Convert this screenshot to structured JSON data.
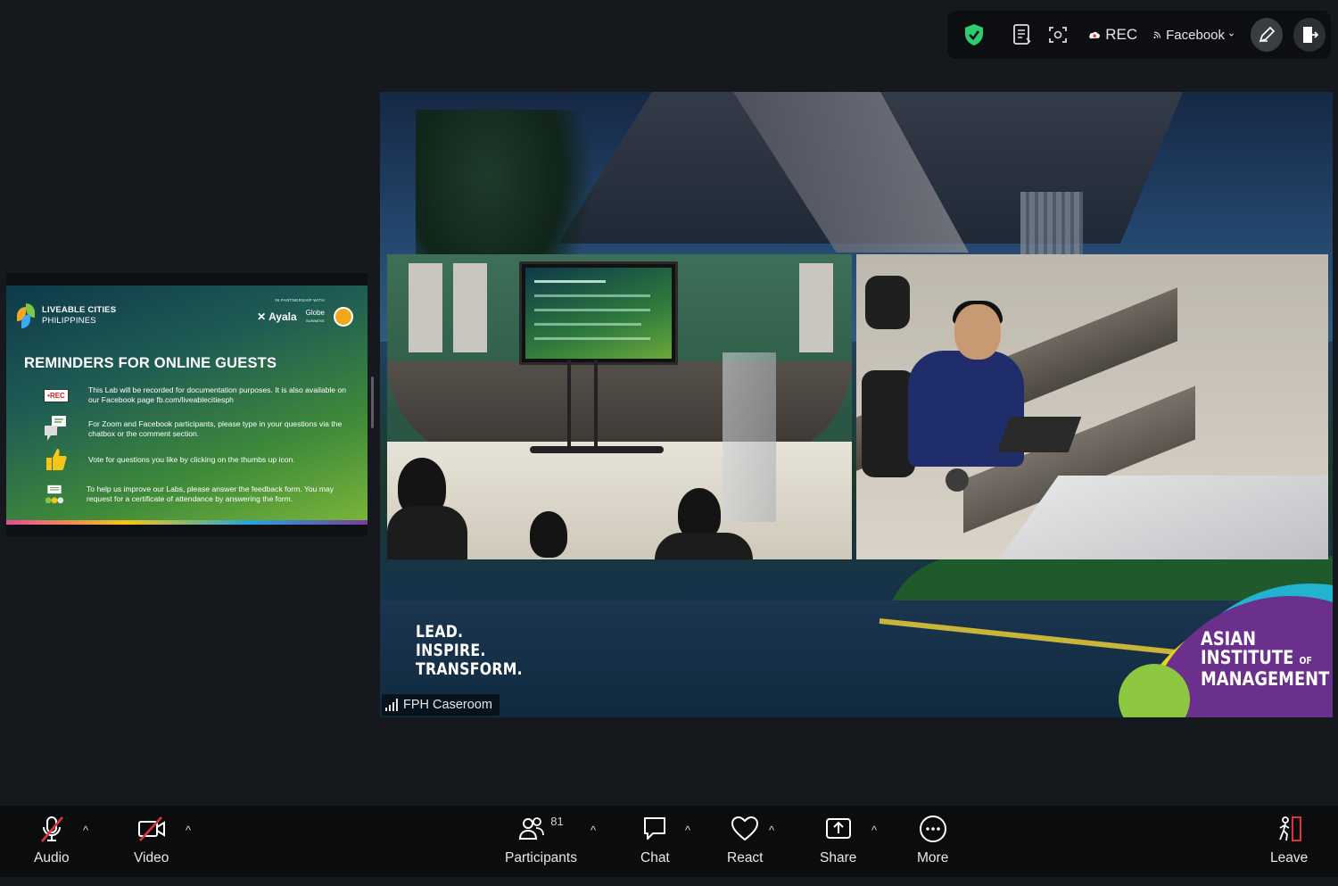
{
  "toolbar_top": {
    "rec_label": "REC",
    "live_label": "Facebook"
  },
  "slide": {
    "brand_line1": "LIVEABLE CITIES",
    "brand_line2": "PHILIPPINES",
    "partner_note": "IN PARTNERSHIP WITH",
    "partner_ayala": "Ayala",
    "partner_globe": "Globe",
    "partner_globe_sub": "BUSINESS",
    "title": "REMINDERS FOR ONLINE GUESTS",
    "rec_badge": "•REC",
    "items": [
      "This Lab will be recorded for documentation purposes. It is also available on our Facebook page fb.com/liveablecitiesph",
      "For Zoom and Facebook participants, please type in your questions via the chatbox or the comment section.",
      "Vote for questions you like by clicking on the thumbs up icon.",
      "To help us improve our Labs, please answer the feedback form. You may request for a certificate of attendance by answering the form."
    ]
  },
  "video": {
    "tagline": [
      "LEAD.",
      "INSPIRE.",
      "TRANSFORM."
    ],
    "logo_line1": "ASIAN",
    "logo_line2": "INSTITUTE",
    "logo_of": "OF",
    "logo_line3": "MANAGEMENT",
    "participant_name": "FPH Caseroom"
  },
  "toolbar_bottom": {
    "audio": "Audio",
    "video": "Video",
    "participants": "Participants",
    "participant_count": "81",
    "chat": "Chat",
    "react": "React",
    "share": "Share",
    "more": "More",
    "leave": "Leave"
  },
  "colors": {
    "background": "#15181d",
    "toolbar": "#0b0c0e",
    "security_green": "#2ecc71",
    "muted_red": "#e0323a",
    "aim_purple": "#6b2f8c",
    "aim_yellow": "#e8d31c",
    "aim_cyan": "#21b3cf"
  },
  "icons": {
    "security": "shield-check-icon",
    "transcript": "document-icon",
    "focus": "focus-scan-icon",
    "cloud_rec": "cloud-record-icon",
    "live": "broadcast-icon",
    "annotate": "pencil-icon",
    "exit_share": "door-icon",
    "audio": "mic-muted-icon",
    "video": "camera-off-icon",
    "participants": "people-icon",
    "chat": "chat-bubble-icon",
    "react": "heart-icon",
    "share": "share-up-icon",
    "more": "ellipsis-icon",
    "leave": "exit-person-icon"
  }
}
